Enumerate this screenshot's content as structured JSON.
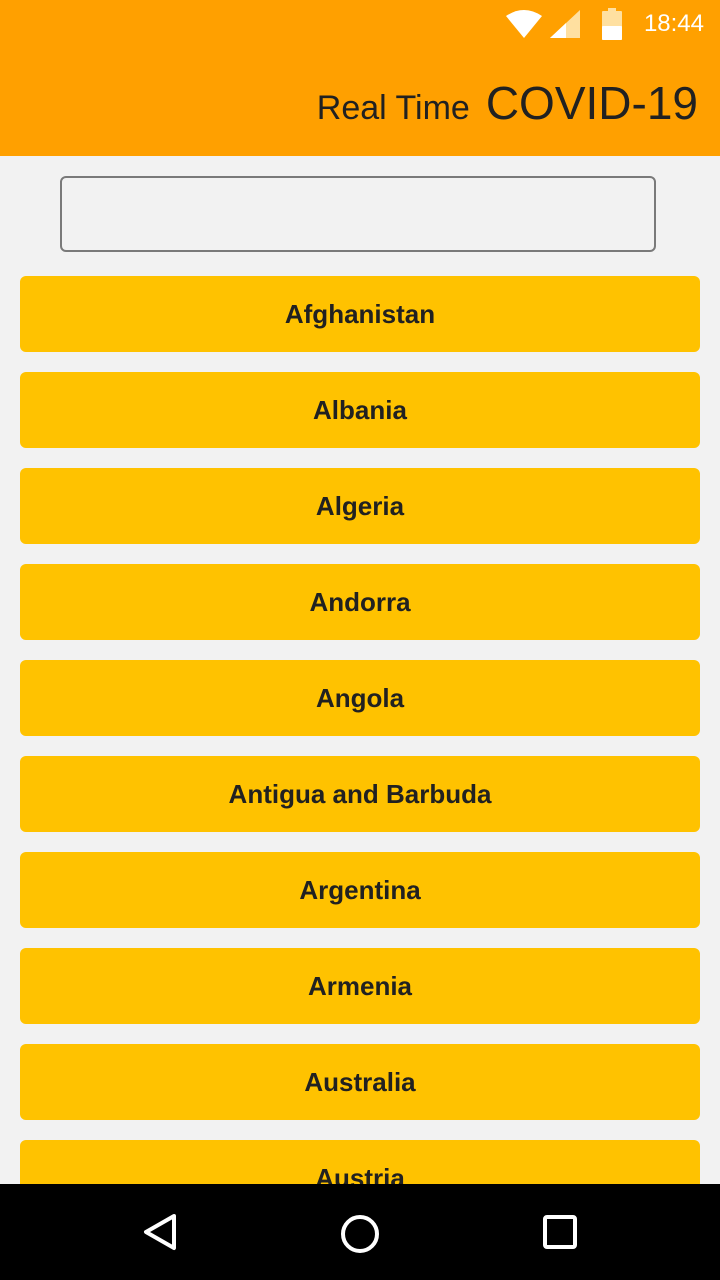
{
  "status_bar": {
    "time": "18:44",
    "icons": [
      "wifi-icon",
      "cell-signal-icon",
      "battery-icon"
    ]
  },
  "app_bar": {
    "title_small": "Real Time",
    "title_large": "COVID-19",
    "background_color": "#ffa000"
  },
  "search": {
    "value": "",
    "placeholder": ""
  },
  "countries": [
    {
      "label": "Afghanistan"
    },
    {
      "label": "Albania"
    },
    {
      "label": "Algeria"
    },
    {
      "label": "Andorra"
    },
    {
      "label": "Angola"
    },
    {
      "label": "Antigua and Barbuda"
    },
    {
      "label": "Argentina"
    },
    {
      "label": "Armenia"
    },
    {
      "label": "Australia"
    },
    {
      "label": "Austria"
    }
  ],
  "colors": {
    "button": "#ffc200",
    "background": "#f2f2f2"
  },
  "nav_bar": {
    "icons": [
      "back-icon",
      "home-icon",
      "recent-apps-icon"
    ]
  }
}
